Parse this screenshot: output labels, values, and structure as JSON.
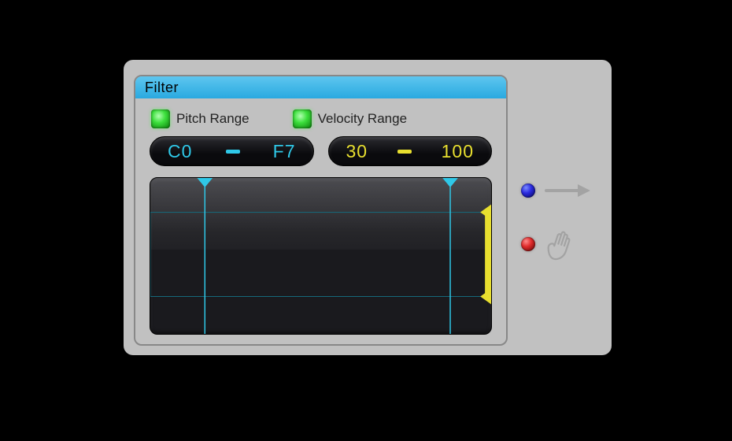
{
  "panel": {
    "title": "Filter",
    "pitch": {
      "label": "Pitch Range",
      "low": "C0",
      "high": "F7",
      "enabled": true
    },
    "velocity": {
      "label": "Velocity Range",
      "low": "30",
      "high": "100",
      "enabled": true
    }
  },
  "graph": {
    "pitchLowPct": 16,
    "pitchHighPct": 88,
    "velLowPct": 24,
    "velHighPct": 78
  },
  "colors": {
    "cyan": "#2fc8e8",
    "yellow": "#e8df2f",
    "darkcyan": "#176b7c"
  }
}
